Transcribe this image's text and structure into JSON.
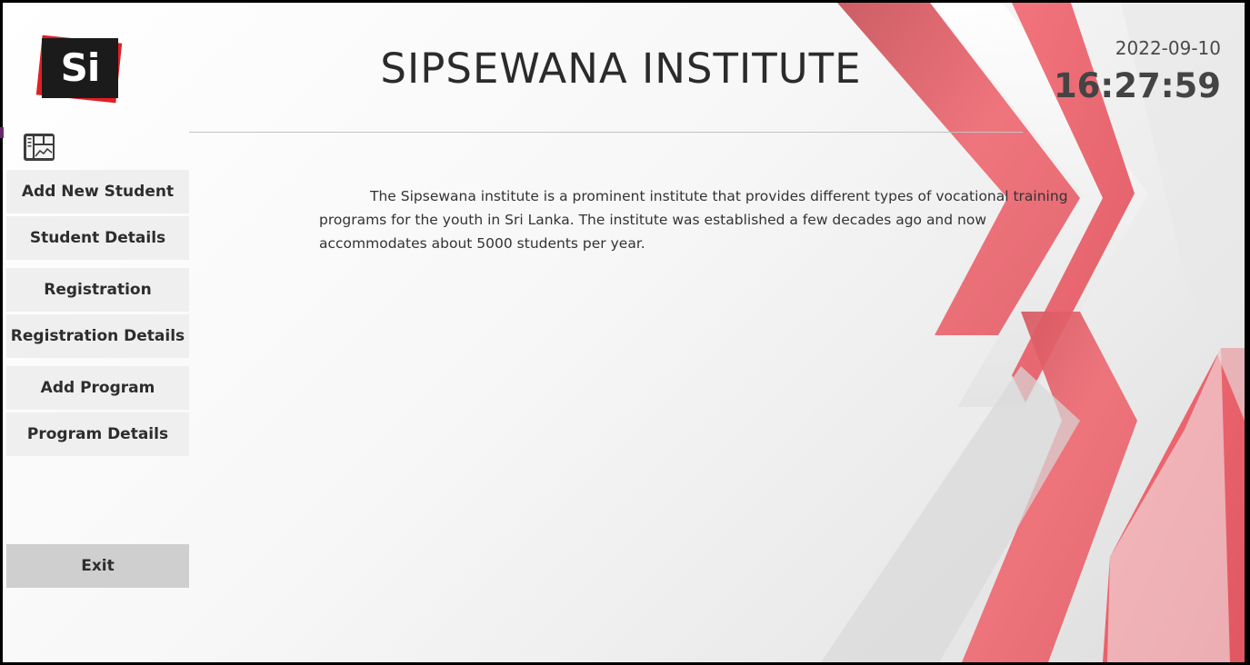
{
  "app": {
    "logo_text": "Si",
    "title": "SIPSEWANA INSTITUTE"
  },
  "clock": {
    "date": "2022-09-10",
    "time": "16:27:59"
  },
  "sidebar": {
    "icon": "dashboard-icon",
    "items": [
      {
        "label": "Add New Student"
      },
      {
        "label": "Student Details"
      },
      {
        "label": "Registration"
      },
      {
        "label": "Registration Details"
      },
      {
        "label": "Add Program"
      },
      {
        "label": "Program Details"
      }
    ],
    "exit_label": "Exit"
  },
  "main": {
    "description": "The Sipsewana institute is a prominent institute that provides different types of vocational training programs for the youth in Sri Lanka. The institute was established a few decades ago and now accommodates about 5000 students per year."
  },
  "colors": {
    "accent_red": "#f0616b",
    "logo_red": "#e01f26",
    "logo_black": "#1b1b1b",
    "button_bg": "#efefef",
    "exit_bg": "#cfcfcf"
  }
}
